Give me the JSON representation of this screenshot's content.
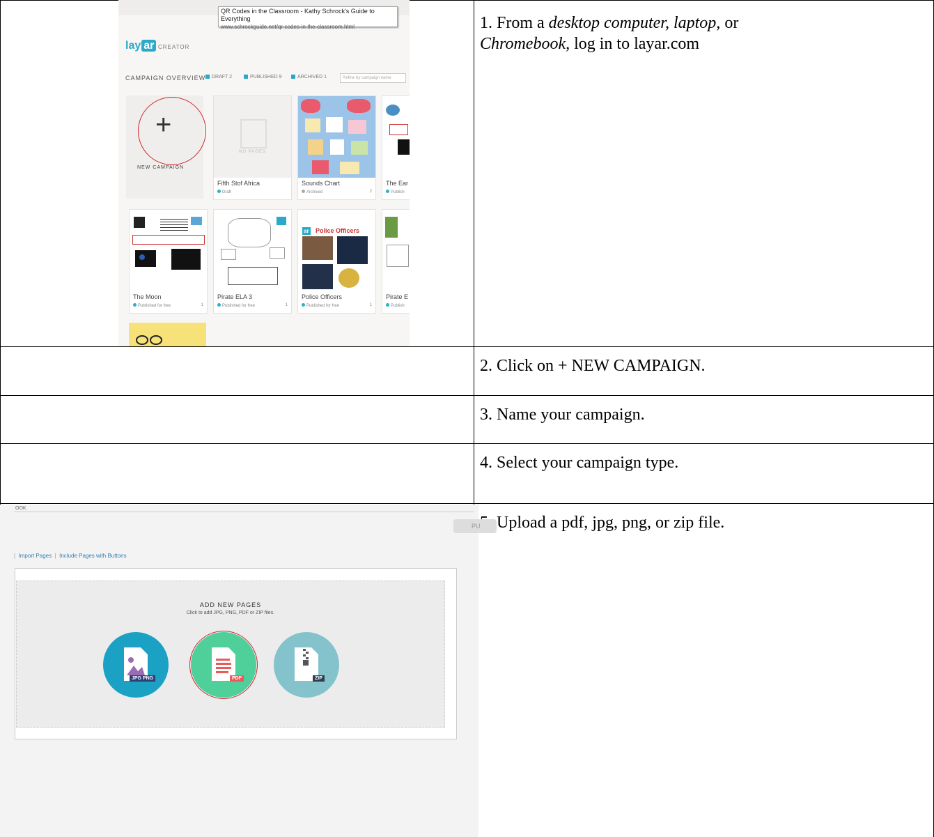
{
  "steps": {
    "s1_a": "1. From a ",
    "s1_b": "desktop computer, laptop,",
    "s1_c": " or",
    "s1_d": "Chromebook,",
    "s1_e": " log in to layar.com",
    "s2": "2. Click on + NEW CAMPAIGN.",
    "s3": "3. Name your campaign.",
    "s4": "4. Select your campaign type.",
    "s5": "5.  Upload a pdf, jpg, png, or zip file."
  },
  "shot1": {
    "tooltip_title": "QR Codes in the Classroom - Kathy Schrock's Guide to Everything",
    "tooltip_url": "www.schrockguide.net/qr-codes-in-the-classroom.html",
    "logo_lay": "lay",
    "logo_ar": "ar",
    "creator": "CREATOR",
    "overview": "CAMPAIGN OVERVIEW",
    "filters": [
      "DRAFT 2",
      "PUBLISHED 9",
      "ARCHIVED 1"
    ],
    "refine_placeholder": "Refine by campaign name",
    "new_campaign": "NEW CAMPAIGN",
    "no_pages": "NO PAGES",
    "cards": [
      {
        "name": "Fifth Stof Africa",
        "status": "Draft"
      },
      {
        "name": "Sounds Chart",
        "status": "Archived",
        "count": "2"
      },
      {
        "name": "The Ear",
        "status": "Publish"
      },
      {
        "name": "The Moon",
        "status": "Published for free",
        "count": "1"
      },
      {
        "name": "Pirate ELA 3",
        "status": "Published for free",
        "count": "1"
      },
      {
        "name": "Police Officers",
        "status": "Published for free",
        "count": "1"
      },
      {
        "name": "Pirate E",
        "status": "Publish"
      }
    ],
    "police_title": "Police Officers",
    "police_badge": "ar"
  },
  "shot2": {
    "top_tab": "OOK",
    "tab_links": [
      "Import Pages",
      "Include Pages with Buttons"
    ],
    "add_title": "ADD NEW PAGES",
    "add_sub": "Click to add JPG, PNG, PDF or ZIP files.",
    "publish": "PU",
    "buttons": [
      {
        "label": "JPG PNG",
        "color": "#1aa1c4"
      },
      {
        "label": "PDF",
        "color": "#4fcf9a"
      },
      {
        "label": "ZIP",
        "color": "#85c3cc"
      }
    ]
  }
}
